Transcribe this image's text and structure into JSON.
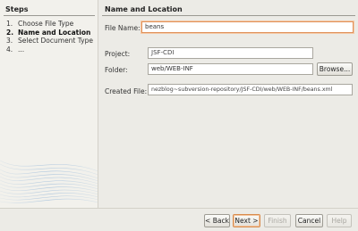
{
  "steps": {
    "title": "Steps",
    "items": [
      {
        "num": "1.",
        "label": "Choose File Type"
      },
      {
        "num": "2.",
        "label": "Name and Location"
      },
      {
        "num": "3.",
        "label": "Select Document Type"
      },
      {
        "num": "4.",
        "label": "..."
      }
    ]
  },
  "main": {
    "title": "Name and Location",
    "file_name": {
      "label": "File Name:",
      "value": "beans"
    },
    "project": {
      "label": "Project:",
      "value": "JSF-CDI"
    },
    "folder": {
      "label": "Folder:",
      "value": "web/WEB-INF"
    },
    "browse_label": "Browse...",
    "created_file": {
      "label": "Created File:",
      "value": "nezblog~subversion-repository/JSF-CDI/web/WEB-INF/beans.xml"
    }
  },
  "buttons": {
    "back": "< Back",
    "next": "Next >",
    "finish": "Finish",
    "cancel": "Cancel",
    "help": "Help"
  },
  "colors": {
    "focus_border": "#e0915a",
    "panel_bg": "#ecebe6"
  }
}
